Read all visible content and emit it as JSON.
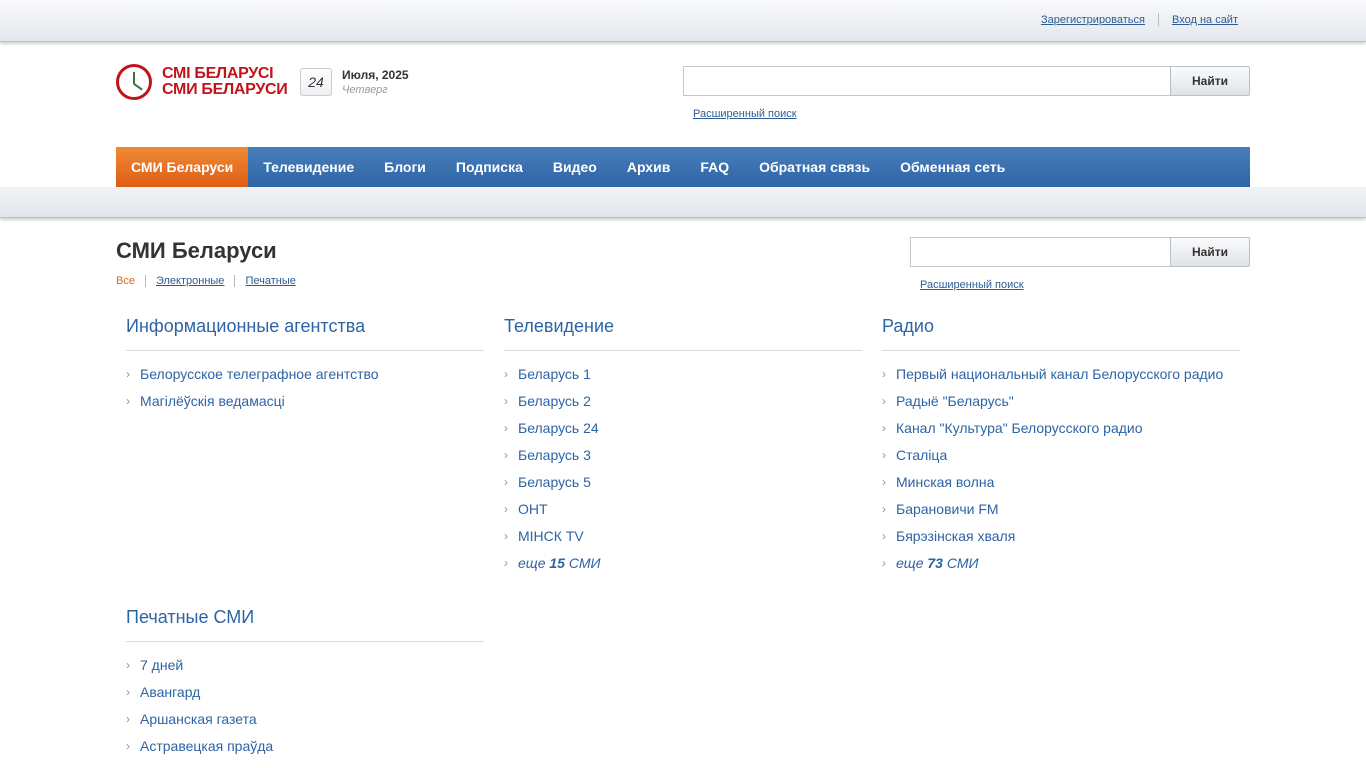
{
  "topbar": {
    "register": "Зарегистрироваться",
    "login": "Вход на сайт"
  },
  "logo": {
    "line1": "СМІ БЕЛАРУСІ",
    "line2": "СМИ БЕЛАРУСИ"
  },
  "date": {
    "day_num": "24",
    "month_year": "Июля, 2025",
    "weekday": "Четверг"
  },
  "header_search": {
    "placeholder": "",
    "button": "Найти",
    "advanced": "Расширенный поиск"
  },
  "nav": [
    {
      "label": "СМИ Беларуси",
      "active": true
    },
    {
      "label": "Телевидение"
    },
    {
      "label": "Блоги"
    },
    {
      "label": "Подписка"
    },
    {
      "label": "Видео"
    },
    {
      "label": "Архив"
    },
    {
      "label": "FAQ"
    },
    {
      "label": "Обратная связь"
    },
    {
      "label": "Обменная сеть"
    }
  ],
  "page": {
    "title": "СМИ Беларуси",
    "filters": {
      "all": "Все",
      "electronic": "Электронные",
      "print": "Печатные"
    },
    "search": {
      "placeholder": "",
      "button": "Найти",
      "advanced": "Расширенный поиск"
    }
  },
  "sections": {
    "agencies": {
      "title": "Информационные агентства",
      "items": [
        "Белорусское телеграфное агентство",
        "Магілёўскія ведамасці"
      ]
    },
    "tv": {
      "title": "Телевидение",
      "items": [
        "Беларусь 1",
        "Беларусь 2",
        "Беларусь 24",
        "Беларусь 3",
        "Беларусь 5",
        "ОНТ",
        "МIНСК TV"
      ],
      "more_prefix": "еще",
      "more_count": "15",
      "more_suffix": "СМИ"
    },
    "radio": {
      "title": "Радио",
      "items": [
        "Первый национальный канал Белорусского радио",
        "Радыё \"Беларусь\"",
        "Канал \"Культура\" Белорусского радио",
        "Сталіца",
        "Минская волна",
        "Барановичи FM",
        "Бярэзінская хваля"
      ],
      "more_prefix": "еще",
      "more_count": "73",
      "more_suffix": "СМИ"
    },
    "print": {
      "title": "Печатные СМИ",
      "items": [
        "7 дней",
        "Авангард",
        "Аршанская газета",
        "Астравецкая праўда"
      ]
    }
  }
}
